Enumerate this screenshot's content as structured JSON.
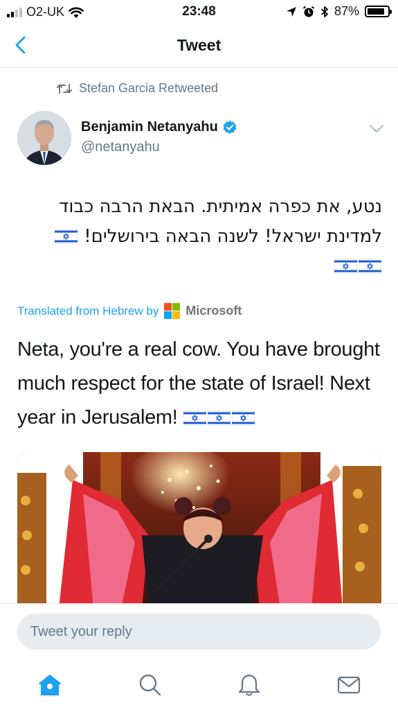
{
  "status_bar": {
    "carrier": "O2-UK",
    "time": "23:48",
    "battery": "87%",
    "battery_level": 0.87,
    "icons": [
      "wifi-icon",
      "location-arrow-icon",
      "alarm-icon",
      "bluetooth-icon",
      "battery-icon"
    ]
  },
  "nav": {
    "title": "Tweet",
    "back_icon": "chevron-left-icon"
  },
  "tweet": {
    "retweeted_by": "Stefan Garcia Retweeted",
    "author_name": "Benjamin Netanyahu",
    "author_handle": "@netanyahu",
    "hebrew_line1": "נטע, את כפרה אמיתית. הבאת הרבה כבוד",
    "hebrew_line2": "למדינת ישראל! לשנה הבאה בירושלים!",
    "translated_label": "Translated from Hebrew by",
    "translator": "Microsoft",
    "translation": "Neta, you're a real cow. You have brought much respect for the state of Israel! Next year in Jerusalem!"
  },
  "reply": {
    "placeholder": "Tweet your reply"
  },
  "tabs": [
    "home-icon",
    "search-icon",
    "notifications-bell-icon",
    "messages-envelope-icon"
  ],
  "colors": {
    "accent": "#1da1f2",
    "secondary_text": "#657786",
    "reply_bg": "#e6ecf0"
  }
}
